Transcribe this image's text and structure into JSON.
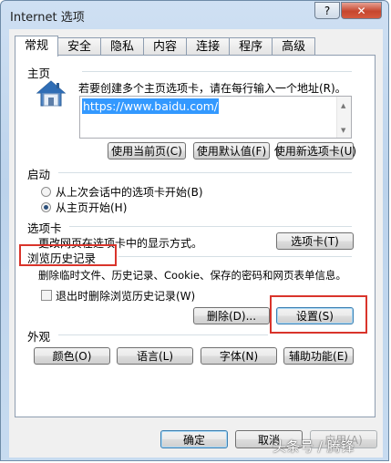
{
  "window": {
    "title": "Internet 选项",
    "help_glyph": "?",
    "close_glyph": "✕"
  },
  "tabs": [
    "常规",
    "安全",
    "隐私",
    "内容",
    "连接",
    "程序",
    "高级"
  ],
  "home": {
    "heading": "主页",
    "description": "若要创建多个主页选项卡，请在每行输入一个地址(R)。",
    "url": "https://www.baidu.com/",
    "buttons": [
      "使用当前页(C)",
      "使用默认值(F)",
      "使用新选项卡(U)"
    ]
  },
  "startup": {
    "heading": "启动",
    "options": [
      "从上次会话中的选项卡开始(B)",
      "从主页开始(H)"
    ],
    "selected_index": 1
  },
  "tabs_section": {
    "heading": "选项卡",
    "description": "更改网页在选项卡中的显示方式。",
    "button": "选项卡(T)"
  },
  "history": {
    "heading": "浏览历史记录",
    "description": "删除临时文件、历史记录、Cookie、保存的密码和网页表单信息。",
    "checkbox_label": "退出时删除浏览历史记录(W)",
    "checkbox_checked": false,
    "delete_button": "删除(D)...",
    "settings_button": "设置(S)"
  },
  "appearance": {
    "heading": "外观",
    "buttons": [
      "颜色(O)",
      "语言(L)",
      "字体(N)",
      "辅助功能(E)"
    ]
  },
  "footer": {
    "ok": "确定",
    "cancel": "取消",
    "apply": "应用(A)"
  },
  "watermark": "头条号 / 腾锋",
  "colors": {
    "highlight_box": "#d9342b",
    "selection": "#3399ff",
    "close_button": "#c6462e"
  },
  "icons": {
    "home": "house-icon"
  }
}
